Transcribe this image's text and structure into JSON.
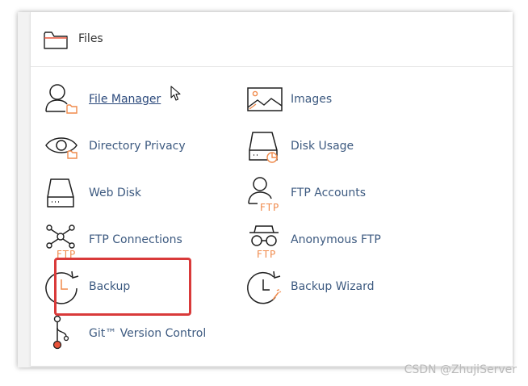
{
  "panel": {
    "title": "Files",
    "icon": "folder-icon"
  },
  "tools": [
    {
      "label": "File Manager",
      "icon": "file-manager-icon",
      "hovered": true
    },
    {
      "label": "Images",
      "icon": "images-icon"
    },
    {
      "label": "Directory Privacy",
      "icon": "directory-privacy-icon"
    },
    {
      "label": "Disk Usage",
      "icon": "disk-usage-icon"
    },
    {
      "label": "Web Disk",
      "icon": "web-disk-icon"
    },
    {
      "label": "FTP Accounts",
      "icon": "ftp-accounts-icon"
    },
    {
      "label": "FTP Connections",
      "icon": "ftp-connections-icon"
    },
    {
      "label": "Anonymous FTP",
      "icon": "anonymous-ftp-icon"
    },
    {
      "label": "Backup",
      "icon": "backup-icon",
      "highlighted": true
    },
    {
      "label": "Backup Wizard",
      "icon": "backup-wizard-icon"
    },
    {
      "label": "Git™ Version Control",
      "icon": "git-icon"
    }
  ],
  "icon_text": {
    "ftp": "FTP"
  },
  "watermark": "CSDN @ZhujiServer",
  "colors": {
    "link": "#3d5a80",
    "accent": "#f08a4b",
    "icon_stroke": "#1f1f1f",
    "highlight": "#d93a3a",
    "git_dot": "#e8533a"
  }
}
